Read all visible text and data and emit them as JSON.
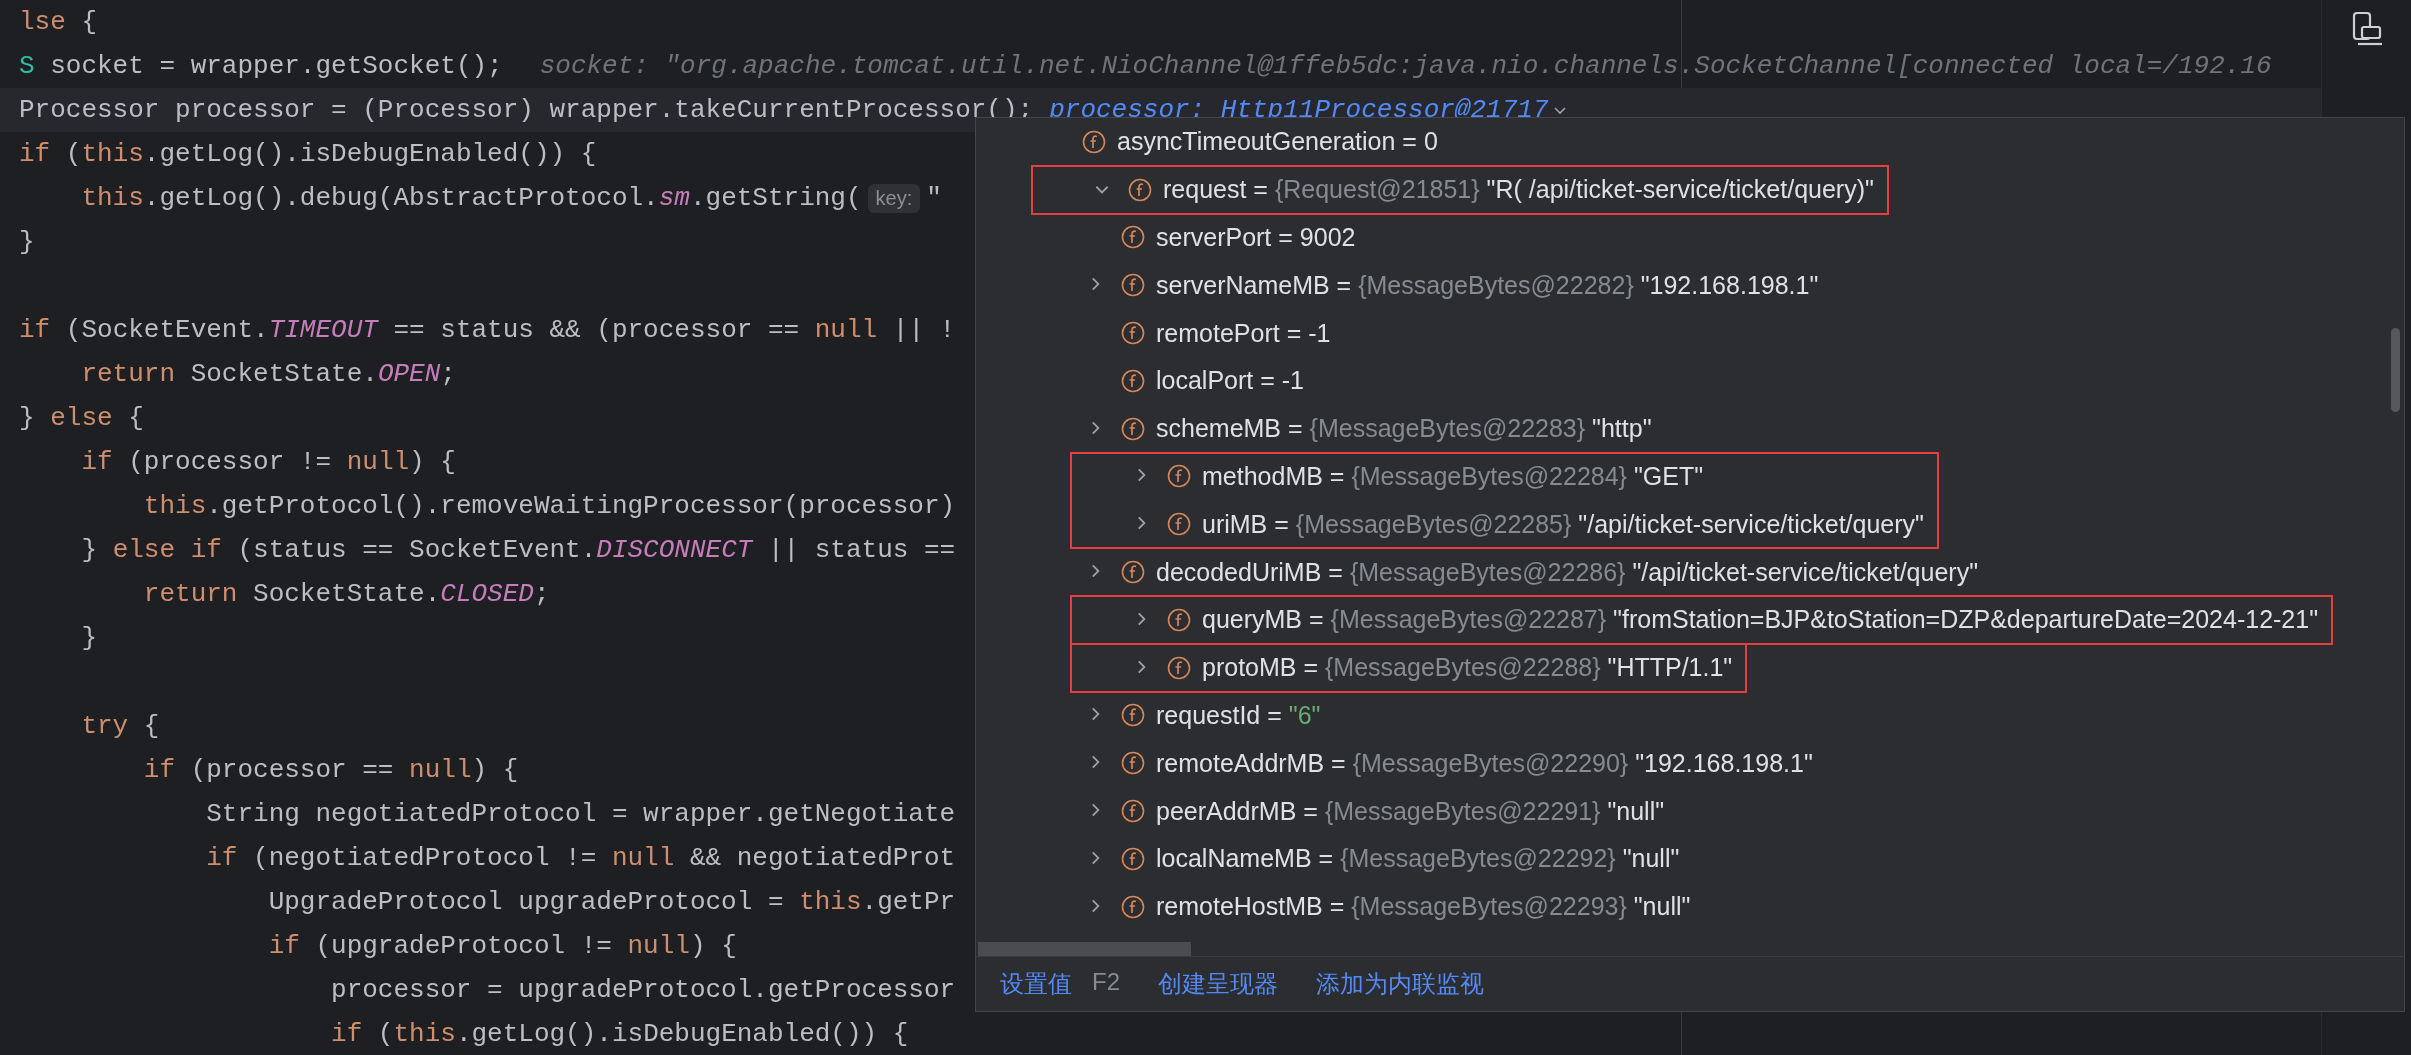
{
  "editor": {
    "lines": [
      {
        "current": false,
        "segments": [
          {
            "kind": "keyword",
            "text": "lse"
          },
          {
            "kind": "plain",
            "text": " {"
          }
        ]
      },
      {
        "current": false,
        "segments": [
          {
            "kind": "type_param",
            "text": "S"
          },
          {
            "kind": "plain",
            "text": " socket = wrapper.getSocket();"
          },
          {
            "kind": "hint",
            "text": "socket: \"org.apache.tomcat.util.net.NioChannel@1ffeb5dc:java.nio.channels.SocketChannel[connected local=/192.16"
          }
        ]
      },
      {
        "current": true,
        "segments": [
          {
            "kind": "plain",
            "text": "Processor processor = (Processor) wrapper.takeCurrentProcessor();"
          },
          {
            "kind": "value_hint",
            "text": "processor: Http11Processor@21717"
          }
        ]
      },
      {
        "current": false,
        "segments": [
          {
            "kind": "keyword",
            "text": "if"
          },
          {
            "kind": "plain",
            "text": " ("
          },
          {
            "kind": "keyword",
            "text": "this"
          },
          {
            "kind": "plain",
            "text": ".getLog().isDebugEnabled()) {"
          }
        ]
      },
      {
        "current": false,
        "segments": [
          {
            "kind": "keyword",
            "text": "    this"
          },
          {
            "kind": "plain",
            "text": ".getLog().debug(AbstractProtocol."
          },
          {
            "kind": "constant",
            "text": "sm"
          },
          {
            "kind": "plain",
            "text": ".getString("
          },
          {
            "kind": "inlay",
            "text": "key:"
          },
          {
            "kind": "plain",
            "text": "\""
          }
        ]
      },
      {
        "current": false,
        "segments": [
          {
            "kind": "plain",
            "text": "}"
          }
        ]
      },
      {
        "current": false
      },
      {
        "current": false,
        "segments": [
          {
            "kind": "keyword",
            "text": "if"
          },
          {
            "kind": "plain",
            "text": " (SocketEvent."
          },
          {
            "kind": "constant",
            "text": "TIMEOUT"
          },
          {
            "kind": "plain",
            "text": " == status && (processor == "
          },
          {
            "kind": "keyword",
            "text": "null"
          },
          {
            "kind": "plain",
            "text": " || !"
          }
        ]
      },
      {
        "current": false,
        "segments": [
          {
            "kind": "keyword",
            "text": "    return"
          },
          {
            "kind": "plain",
            "text": " SocketState."
          },
          {
            "kind": "constant",
            "text": "OPEN"
          },
          {
            "kind": "plain",
            "text": ";"
          }
        ]
      },
      {
        "current": false,
        "segments": [
          {
            "kind": "plain",
            "text": "} "
          },
          {
            "kind": "keyword",
            "text": "else"
          },
          {
            "kind": "plain",
            "text": " {"
          }
        ]
      },
      {
        "current": false,
        "segments": [
          {
            "kind": "keyword",
            "text": "    if"
          },
          {
            "kind": "plain",
            "text": " (processor != "
          },
          {
            "kind": "keyword",
            "text": "null"
          },
          {
            "kind": "plain",
            "text": ") {"
          }
        ]
      },
      {
        "current": false,
        "segments": [
          {
            "kind": "keyword",
            "text": "        this"
          },
          {
            "kind": "plain",
            "text": ".getProtocol().removeWaitingProcessor(processor)"
          }
        ]
      },
      {
        "current": false,
        "segments": [
          {
            "kind": "plain",
            "text": "    } "
          },
          {
            "kind": "keyword",
            "text": "else if"
          },
          {
            "kind": "plain",
            "text": " (status == SocketEvent."
          },
          {
            "kind": "constant",
            "text": "DISCONNECT"
          },
          {
            "kind": "plain",
            "text": " || status =="
          }
        ]
      },
      {
        "current": false,
        "segments": [
          {
            "kind": "keyword",
            "text": "        return"
          },
          {
            "kind": "plain",
            "text": " SocketState."
          },
          {
            "kind": "constant",
            "text": "CLOSED"
          },
          {
            "kind": "plain",
            "text": ";"
          }
        ]
      },
      {
        "current": false,
        "segments": [
          {
            "kind": "plain",
            "text": "    }"
          }
        ]
      },
      {
        "current": false
      },
      {
        "current": false,
        "segments": [
          {
            "kind": "keyword",
            "text": "    try"
          },
          {
            "kind": "plain",
            "text": " {"
          }
        ]
      },
      {
        "current": false,
        "segments": [
          {
            "kind": "keyword",
            "text": "        if"
          },
          {
            "kind": "plain",
            "text": " (processor == "
          },
          {
            "kind": "keyword",
            "text": "null"
          },
          {
            "kind": "plain",
            "text": ") {"
          }
        ]
      },
      {
        "current": false,
        "segments": [
          {
            "kind": "plain",
            "text": "            String negotiatedProtocol = wrapper.getNegotiate"
          }
        ]
      },
      {
        "current": false,
        "segments": [
          {
            "kind": "keyword",
            "text": "            if"
          },
          {
            "kind": "plain",
            "text": " (negotiatedProtocol != "
          },
          {
            "kind": "keyword",
            "text": "null"
          },
          {
            "kind": "plain",
            "text": " && negotiatedProt"
          }
        ]
      },
      {
        "current": false,
        "segments": [
          {
            "kind": "plain",
            "text": "                UpgradeProtocol upgradeProtocol = "
          },
          {
            "kind": "keyword",
            "text": "this"
          },
          {
            "kind": "plain",
            "text": ".getPr"
          }
        ]
      },
      {
        "current": false,
        "segments": [
          {
            "kind": "keyword",
            "text": "                if"
          },
          {
            "kind": "plain",
            "text": " (upgradeProtocol != "
          },
          {
            "kind": "keyword",
            "text": "null"
          },
          {
            "kind": "plain",
            "text": ") {"
          }
        ]
      },
      {
        "current": false,
        "segments": [
          {
            "kind": "plain",
            "text": "                    processor = upgradeProtocol.getProcessor"
          }
        ]
      },
      {
        "current": false,
        "segments": [
          {
            "kind": "keyword",
            "text": "                    if"
          },
          {
            "kind": "plain",
            "text": " ("
          },
          {
            "kind": "keyword",
            "text": "this"
          },
          {
            "kind": "plain",
            "text": ".getLog().isDebugEnabled()) {"
          }
        ]
      }
    ]
  },
  "popup": {
    "variables": [
      {
        "kind": "plain",
        "name": "asyncTimeoutGeneration",
        "assign": "=",
        "value": "0",
        "boxed": false
      },
      {
        "kind": "plain",
        "name": "request",
        "assign": "=",
        "type": "{Request@21851}",
        "value": "\"R( /api/ticket-service/ticket/query)\"",
        "boxed": true,
        "expanded": true,
        "children": [
          {
            "kind": "plain",
            "name": "serverPort",
            "assign": "=",
            "value": "9002",
            "boxed": false
          },
          {
            "kind": "plain",
            "name": "serverNameMB",
            "assign": "=",
            "type": "{MessageBytes@22282}",
            "value": "\"192.168.198.1\"",
            "boxed": false,
            "expanded": false
          },
          {
            "kind": "plain",
            "name": "remotePort",
            "assign": "=",
            "value": "-1",
            "boxed": false
          },
          {
            "kind": "plain",
            "name": "localPort",
            "assign": "=",
            "value": "-1",
            "boxed": false
          },
          {
            "kind": "plain",
            "name": "schemeMB",
            "assign": "=",
            "type": "{MessageBytes@22283}",
            "value": "\"http\"",
            "boxed": false,
            "expanded": false
          },
          {
            "kind": "plain",
            "name": "methodMB",
            "assign": "=",
            "type": "{MessageBytes@22284}",
            "value": "\"GET\"",
            "boxed": true,
            "box_continues": true,
            "expanded": false
          },
          {
            "kind": "plain",
            "name": "uriMB",
            "assign": "=",
            "type": "{MessageBytes@22285}",
            "value": "\"/api/ticket-service/ticket/query\"",
            "boxed": true,
            "expanded": false
          },
          {
            "kind": "plain",
            "name": "decodedUriMB",
            "assign": "=",
            "type": "{MessageBytes@22286}",
            "value": "\"/api/ticket-service/ticket/query\"",
            "boxed": false,
            "expanded": false
          },
          {
            "kind": "plain",
            "name": "queryMB",
            "assign": "=",
            "type": "{MessageBytes@22287}",
            "value": "\"fromStation=BJP&toStation=DZP&departureDate=2024-12-21\"",
            "boxed": true,
            "box_continues": false,
            "expanded": false
          },
          {
            "kind": "plain",
            "name": "protoMB",
            "assign": "=",
            "type": "{MessageBytes@22288}",
            "value": "\"HTTP/1.1\"",
            "boxed": true,
            "expanded": false
          },
          {
            "kind": "string",
            "name": "requestId",
            "assign": "=",
            "value": "\"6\"",
            "boxed": false,
            "expanded": false
          },
          {
            "kind": "plain",
            "name": "remoteAddrMB",
            "assign": "=",
            "type": "{MessageBytes@22290}",
            "value": "\"192.168.198.1\"",
            "boxed": false,
            "expanded": false
          },
          {
            "kind": "plain",
            "name": "peerAddrMB",
            "assign": "=",
            "type": "{MessageBytes@22291}",
            "value": "\"null\"",
            "boxed": false,
            "expanded": false
          },
          {
            "kind": "plain",
            "name": "localNameMB",
            "assign": "=",
            "type": "{MessageBytes@22292}",
            "value": "\"null\"",
            "boxed": false,
            "expanded": false
          },
          {
            "kind": "plain",
            "name": "remoteHostMB",
            "assign": "=",
            "type": "{MessageBytes@22293}",
            "value": "\"null\"",
            "boxed": false,
            "expanded": false
          }
        ]
      }
    ],
    "footer": {
      "actions": [
        {
          "label": "设置值",
          "shortcut": "F2"
        },
        {
          "label": "创建呈现器"
        },
        {
          "label": "添加为内联监视"
        }
      ]
    }
  }
}
